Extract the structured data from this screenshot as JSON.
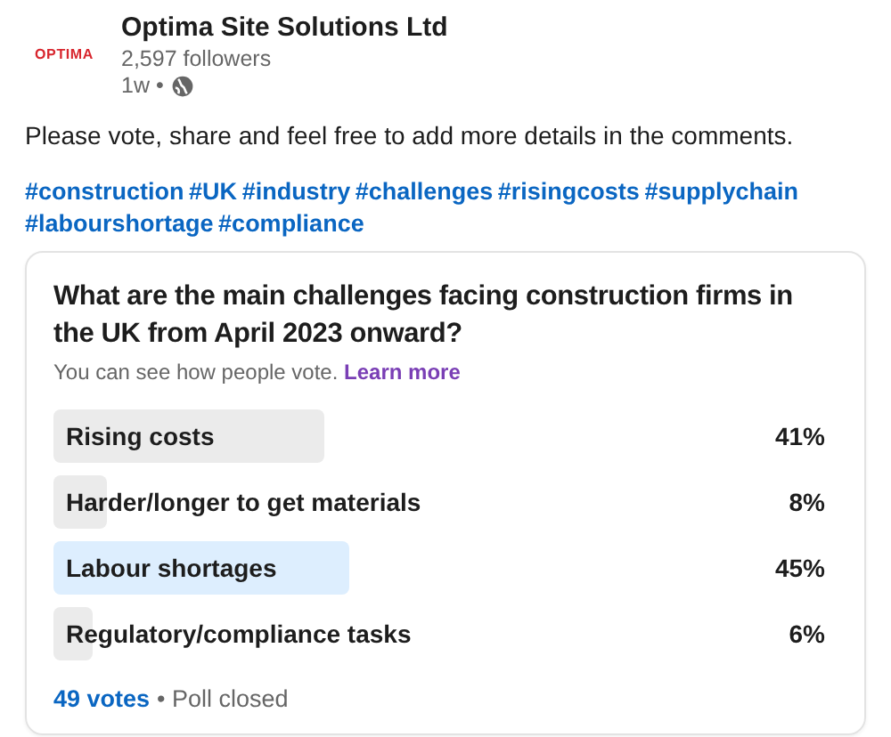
{
  "author": {
    "logo_text": "OPTIMA",
    "name": "Optima Site Solutions Ltd",
    "followers": "2,597 followers",
    "time": "1w •"
  },
  "post_text": "Please vote, share and feel free to add more details in the comments.",
  "hashtags": [
    "#construction",
    "#UK",
    "#industry",
    "#challenges",
    "#risingcosts",
    "#supplychain",
    "#labourshortage",
    "#compliance"
  ],
  "poll": {
    "question": "What are the main challenges facing construction firms in the UK from April 2023 onward?",
    "visibility_note": "You can see how people vote.",
    "learn_more": "Learn more",
    "options": [
      {
        "label": "Rising costs",
        "percent": "41%",
        "selected": false
      },
      {
        "label": "Harder/longer to get materials",
        "percent": "8%",
        "selected": false
      },
      {
        "label": "Labour shortages",
        "percent": "45%",
        "selected": true
      },
      {
        "label": "Regulatory/compliance tasks",
        "percent": "6%",
        "selected": false
      }
    ],
    "votes": "49 votes",
    "status": "• Poll closed"
  }
}
